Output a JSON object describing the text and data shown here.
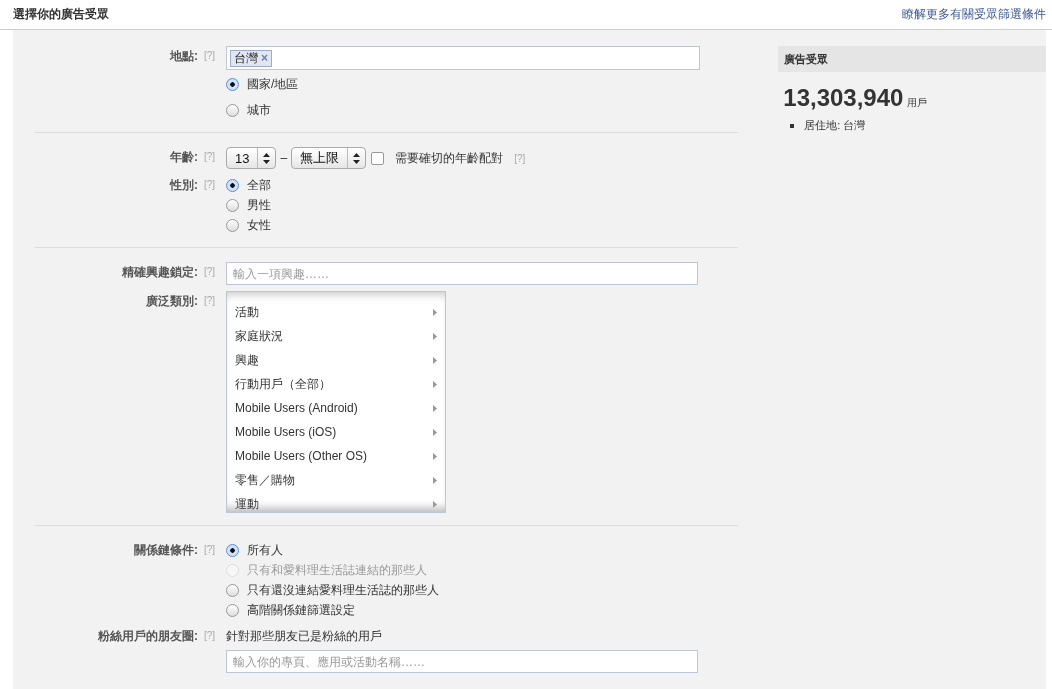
{
  "header": {
    "title": "選擇你的廣告受眾",
    "link": "瞭解更多有關受眾篩選條件"
  },
  "location": {
    "label": "地點:",
    "help": "[?]",
    "tokens": [
      {
        "text": "台灣",
        "remove": "×"
      }
    ],
    "options": [
      {
        "label": "國家/地區",
        "selected": true
      },
      {
        "label": "城市",
        "selected": false
      }
    ]
  },
  "age": {
    "label": "年齡:",
    "help": "[?]",
    "min": "13",
    "separator": "–",
    "max": "無上限",
    "exact_match": {
      "label": "需要確切的年齡配對",
      "checked": false,
      "help": "[?]"
    }
  },
  "gender": {
    "label": "性別:",
    "help": "[?]",
    "options": [
      {
        "label": "全部",
        "selected": true
      },
      {
        "label": "男性",
        "selected": false
      },
      {
        "label": "女性",
        "selected": false
      }
    ]
  },
  "precise_interests": {
    "label": "精確興趣鎖定:",
    "help": "[?]",
    "placeholder": "輸入一項興趣……"
  },
  "broad_categories": {
    "label": "廣泛類別:",
    "help": "[?]",
    "items": [
      {
        "label": "活動"
      },
      {
        "label": "家庭狀況"
      },
      {
        "label": "興趣"
      },
      {
        "label": "行動用戶（全部）"
      },
      {
        "label": "Mobile Users (Android)"
      },
      {
        "label": "Mobile Users (iOS)"
      },
      {
        "label": "Mobile Users (Other OS)"
      },
      {
        "label": "零售／購物"
      },
      {
        "label": "運動"
      }
    ]
  },
  "connections": {
    "label": "關係鏈條件:",
    "help": "[?]",
    "options": [
      {
        "label": "所有人",
        "selected": true,
        "disabled": false
      },
      {
        "label": "只有和愛料理生活誌連結的那些人",
        "selected": false,
        "disabled": true
      },
      {
        "label": "只有還沒連結愛料理生活誌的那些人",
        "selected": false,
        "disabled": false
      },
      {
        "label": "高階關係鏈篩選設定",
        "selected": false,
        "disabled": false
      }
    ]
  },
  "friends_of_fans": {
    "label": "粉絲用戶的朋友圈:",
    "help": "[?]",
    "description": "針對那些朋友已是粉絲的用戶",
    "placeholder": "輸入你的專頁、應用或活動名稱……"
  },
  "audience": {
    "title": "廣告受眾",
    "count": "13,303,940",
    "unit": "用戶",
    "criteria": [
      "居住地: 台灣"
    ]
  }
}
